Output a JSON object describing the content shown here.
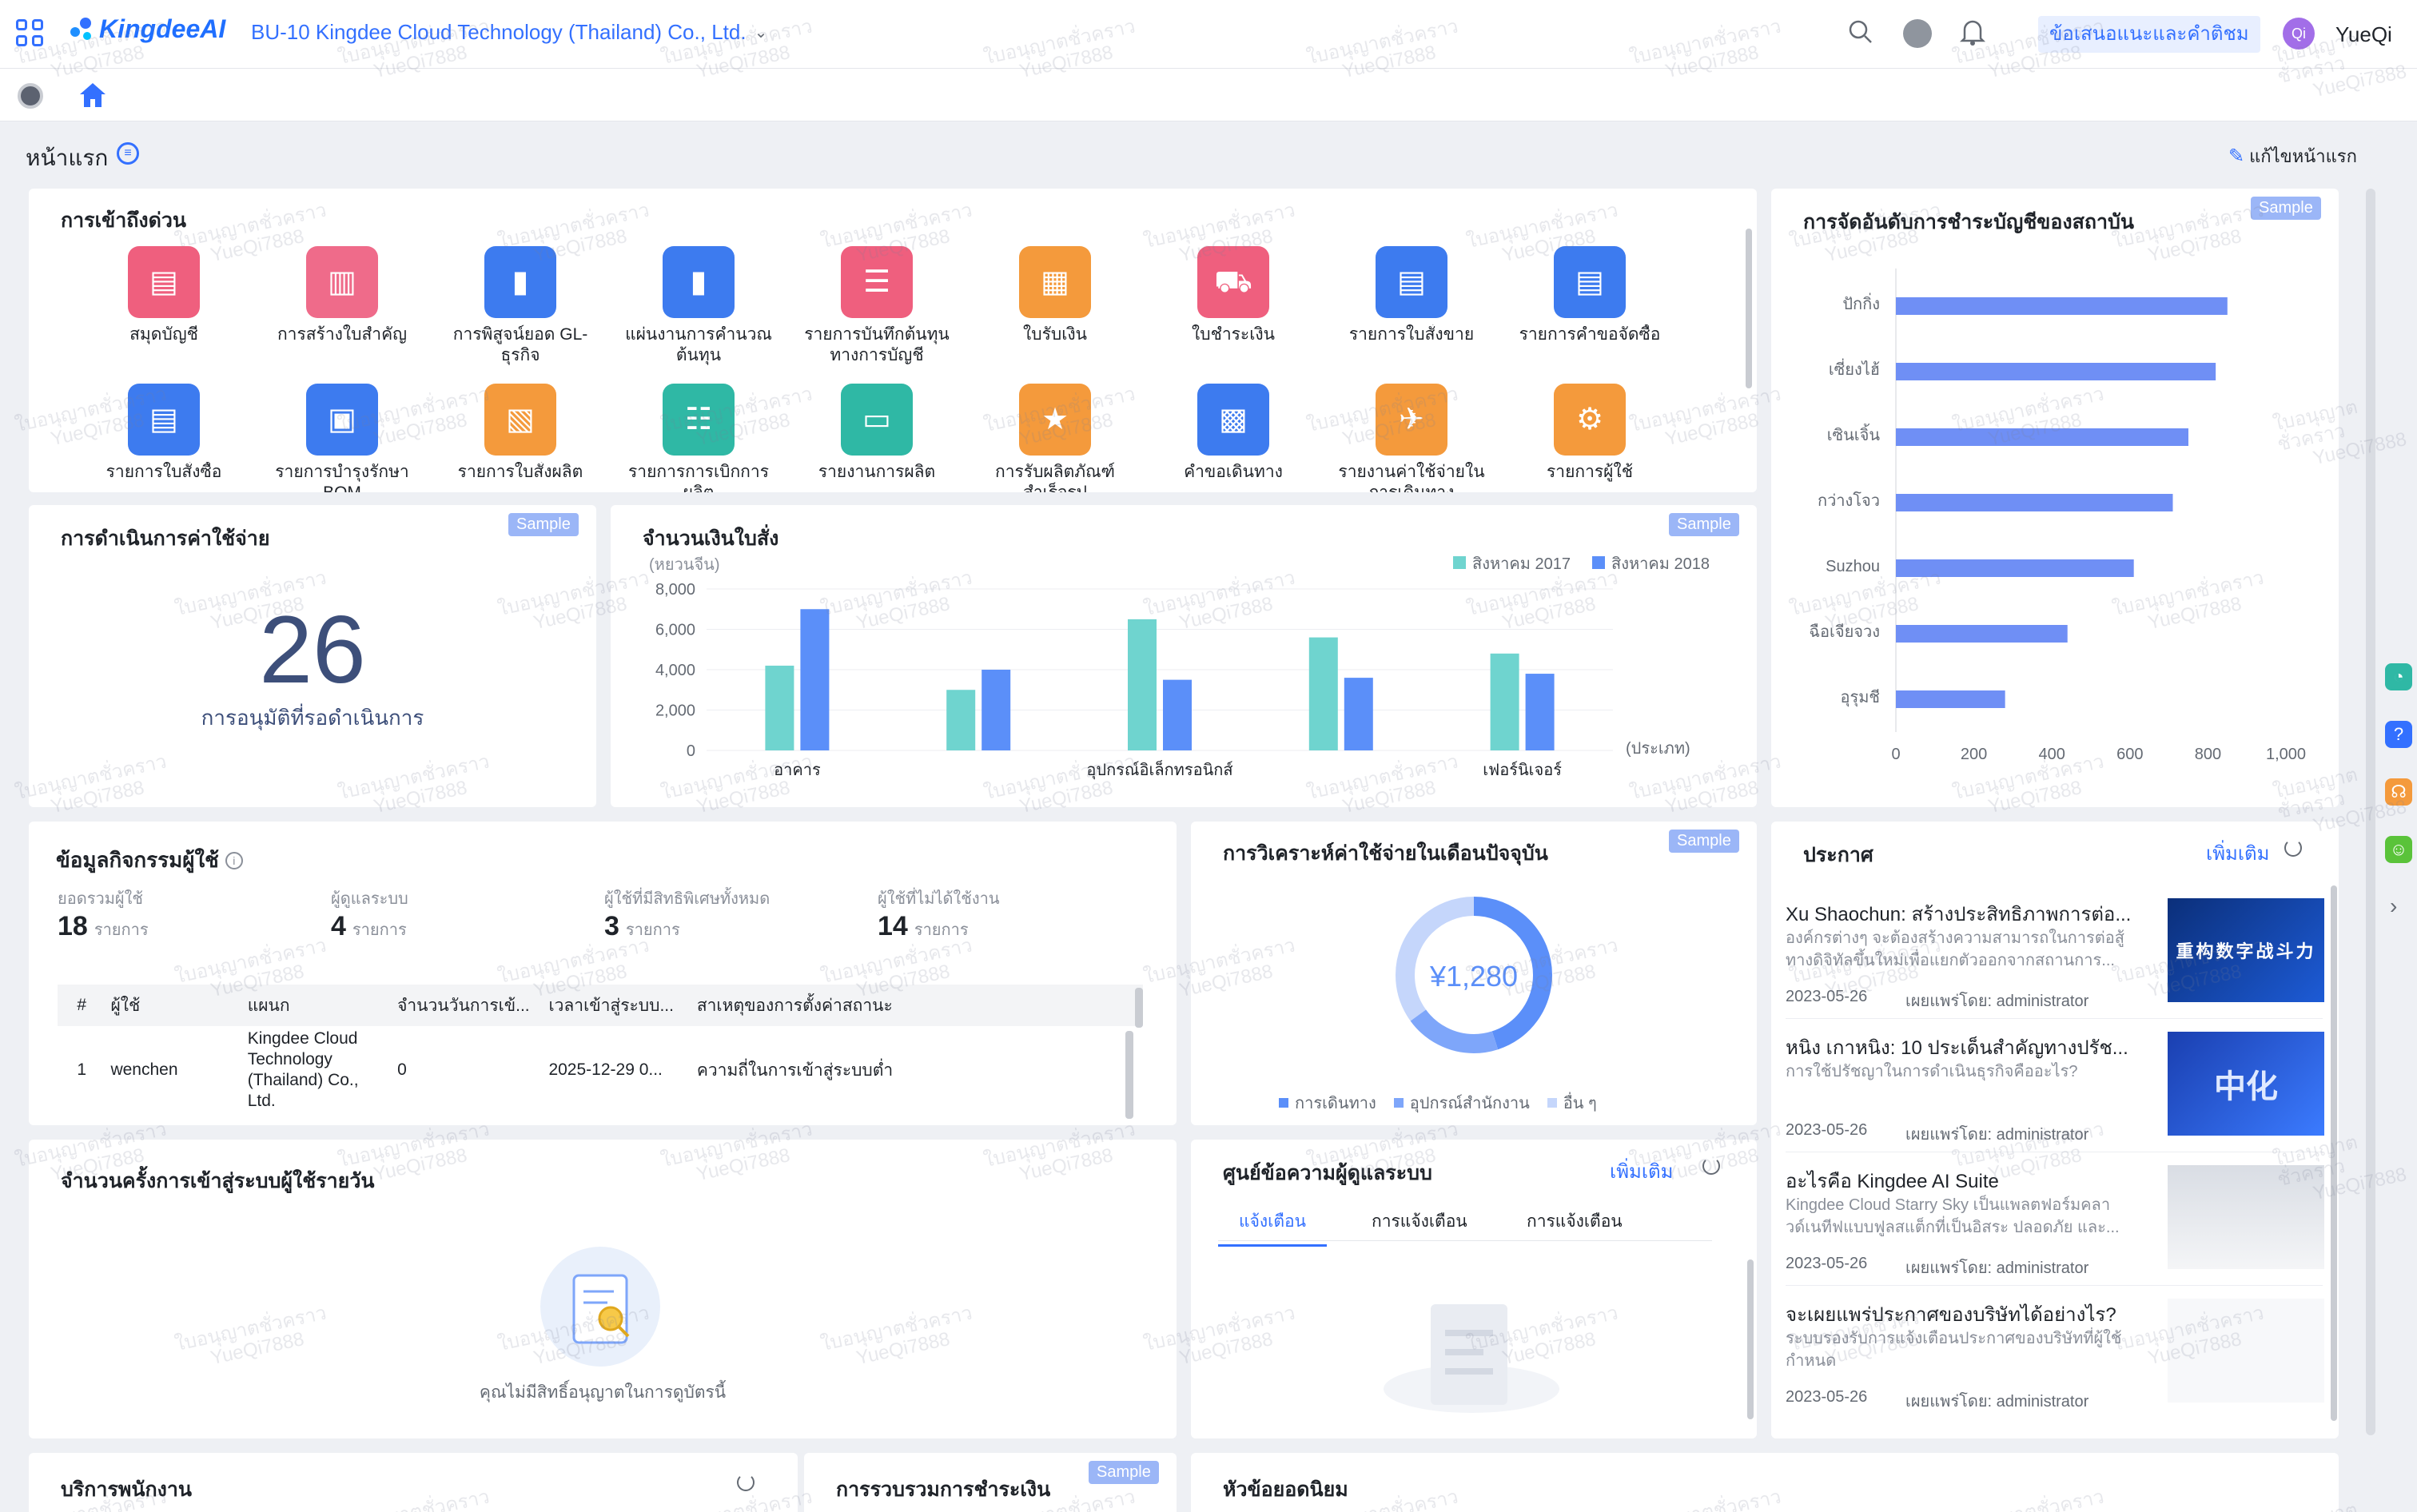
{
  "topbar": {
    "logo_text": "KingdeeAI",
    "org_name": "BU-10 Kingdee Cloud Technology (Thailand) Co., Ltd.",
    "feedback_label": "ข้อเสนอแนะและคำติชม",
    "avatar_initials": "Qi",
    "username": "YueQi"
  },
  "page": {
    "title": "หน้าแรก",
    "edit_label": "แก้ไขหน้าแรก"
  },
  "sample_label": "Sample",
  "quick_access": {
    "title": "การเข้าถึงด่วน",
    "items": [
      {
        "label": "สมุดบัญชี",
        "color": "#ef5f7e",
        "icon": "ledger-icon"
      },
      {
        "label": "การสร้างใบสำคัญ",
        "color": "#ef6b8a",
        "icon": "voucher-icon"
      },
      {
        "label": "การพิสูจน์ยอด GL-ธุรกิจ",
        "color": "#3d7bef",
        "icon": "bookmark-icon"
      },
      {
        "label": "แผ่นงานการคำนวณต้นทุน",
        "color": "#3d7bef",
        "icon": "bookmark-icon"
      },
      {
        "label": "รายการบันทึกต้นทุนทางการบัญชี",
        "color": "#ef5f7e",
        "icon": "list-icon"
      },
      {
        "label": "ใบรับเงิน",
        "color": "#f49a3c",
        "icon": "receipt-icon"
      },
      {
        "label": "ใบชำระเงิน",
        "color": "#ef5f7e",
        "icon": "cart-icon"
      },
      {
        "label": "รายการใบสั่งขาย",
        "color": "#3d7bef",
        "icon": "document-icon"
      },
      {
        "label": "รายการคำขอจัดซื้อ",
        "color": "#3d7bef",
        "icon": "document-icon"
      },
      {
        "label": "รายการใบสั่งซื้อ",
        "color": "#3d7bef",
        "icon": "document-icon"
      },
      {
        "label": "รายการบำรุงรักษา BOM",
        "color": "#3d7bef",
        "icon": "bom-icon"
      },
      {
        "label": "รายการใบสั่งผลิต",
        "color": "#f49a3c",
        "icon": "production-order-icon"
      },
      {
        "label": "รายการการเบิกการผลิต",
        "color": "#2fb8a5",
        "icon": "checklist-icon"
      },
      {
        "label": "รายงานการผลิต",
        "color": "#2fb8a5",
        "icon": "monitor-icon"
      },
      {
        "label": "การรับผลิตภัณฑ์สำเร็จรูป",
        "color": "#f49a3c",
        "icon": "star-icon"
      },
      {
        "label": "คำขอเดินทาง",
        "color": "#3d7bef",
        "icon": "suitcase-icon"
      },
      {
        "label": "รายงานค่าใช้จ่ายในการเดินทาง",
        "color": "#f49a3c",
        "icon": "plane-icon"
      },
      {
        "label": "รายการผู้ใช้",
        "color": "#f49a3c",
        "icon": "user-settings-icon"
      }
    ]
  },
  "expense_ops": {
    "title": "การดำเนินการค่าใช้จ่าย",
    "count": "26",
    "caption": "การอนุมัติที่รอดำเนินการ"
  },
  "order_amount": {
    "title": "จำนวนเงินใบสั่ง",
    "unit_label": "(หยวนจีน)",
    "x_unit_label": "(ประเภท)",
    "legend": [
      "สิงหาคม 2017",
      "สิงหาคม 2018"
    ],
    "colors": [
      "#6fd4cf",
      "#5b8ff9"
    ]
  },
  "ranking": {
    "title": "การจัดอันดับการชำระบัญชีของสถาบัน",
    "color": "#6f8ff5"
  },
  "user_activity": {
    "title": "ข้อมูลกิจกรรมผู้ใช้",
    "stats": [
      {
        "label": "ยอดรวมผู้ใช้",
        "value": "18",
        "unit": "รายการ"
      },
      {
        "label": "ผู้ดูแลระบบ",
        "value": "4",
        "unit": "รายการ"
      },
      {
        "label": "ผู้ใช้ที่มีสิทธิพิเศษทั้งหมด",
        "value": "3",
        "unit": "รายการ"
      },
      {
        "label": "ผู้ใช้ที่ไม่ได้ใช้งาน",
        "value": "14",
        "unit": "รายการ"
      }
    ],
    "columns": [
      "#",
      "ผู้ใช้",
      "แผนก",
      "จำนวนวันการเข้...",
      "เวลาเข้าสู่ระบบ...",
      "สาเหตุของการตั้งค่าสถานะ"
    ],
    "rows": [
      [
        "1",
        "wenchen",
        "Kingdee Cloud Technology (Thailand) Co., Ltd.",
        "0",
        "2025-12-29 0...",
        "ความถี่ในการเข้าสู่ระบบต่ำ"
      ]
    ]
  },
  "expense_analysis": {
    "title": "การวิเคราะห์ค่าใช้จ่ายในเดือนปัจจุบัน",
    "total": "¥1,280",
    "legend": [
      "การเดินทาง",
      "อุปกรณ์สำนักงาน",
      "อื่น ๆ"
    ],
    "colors": [
      "#5b8ff9",
      "#7ea6fa",
      "#c5d6fb"
    ]
  },
  "announcements": {
    "title": "ประกาศ",
    "more_label": "เพิ่มเติม",
    "items": [
      {
        "title": "Xu Shaochun: สร้างประสิทธิภาพการต่อ...",
        "summary": "องค์กรต่างๆ จะต้องสร้างความสามารถในการต่อสู้ทางดิจิทัลขึ้นใหม่เพื่อแยกตัวออกจากสถานการ...",
        "date": "2023-05-26",
        "publisher": "เผยแพร่โดย: administrator",
        "thumb_text": "重构数字战斗力"
      },
      {
        "title": "หนิง เกาหนิง: 10 ประเด็นสำคัญทางปรัช...",
        "summary": "การใช้ปรัชญาในการดำเนินธุรกิจคืออะไร?",
        "date": "2023-05-26",
        "publisher": "เผยแพร่โดย: administrator",
        "thumb_text": "中化"
      },
      {
        "title": "อะไรคือ Kingdee AI Suite",
        "summary": "Kingdee Cloud Starry Sky เป็นแพลตฟอร์มคลาวด์เนทีฟแบบฟูลสแต็กที่เป็นอิสระ ปลอดภัย และ...",
        "date": "2023-05-26",
        "publisher": "เผยแพร่โดย: administrator",
        "thumb_text": ""
      },
      {
        "title": "จะเผยแพร่ประกาศของบริษัทได้อย่างไร?",
        "summary": "ระบบรองรับการแจ้งเตือนประกาศของบริษัทที่ผู้ใช้กำหนด",
        "date": "2023-05-26",
        "publisher": "เผยแพร่โดย: administrator",
        "thumb_text": ""
      }
    ]
  },
  "daily_logins": {
    "title": "จำนวนครั้งการเข้าสู่ระบบผู้ใช้รายวัน",
    "empty_text": "คุณไม่มีสิทธิ์อนุญาตในการดูบัตรนี้"
  },
  "message_center": {
    "title": "ศูนย์ข้อความผู้ดูแลระบบ",
    "more_label": "เพิ่มเติม",
    "tabs": [
      "แจ้งเตือน",
      "การแจ้งเตือน",
      "การแจ้งเตือน"
    ]
  },
  "bottom_cards": {
    "employee_services": "บริการพนักงาน",
    "payment_summary": "การรวบรวมการชำระเงิน",
    "popular_topics": "หัวข้อยอดนิยม"
  },
  "watermark": {
    "line1": "ใบอนุญาตชั่วคราว",
    "line2": "YueQi7888"
  },
  "chart_data": [
    {
      "type": "bar",
      "title": "จำนวนเงินใบสั่ง",
      "ylabel": "(หยวนจีน)",
      "xlabel": "(ประเภท)",
      "categories": [
        "อาคาร",
        "",
        "อุปกรณ์อิเล็กทรอนิกส์",
        "",
        "เฟอร์นิเจอร์"
      ],
      "ylim": [
        0,
        8000
      ],
      "yticks": [
        "0",
        "2,000",
        "4,000",
        "6,000",
        "8,000"
      ],
      "series": [
        {
          "name": "สิงหาคม 2017",
          "values": [
            4200,
            3000,
            6500,
            5600,
            4800
          ]
        },
        {
          "name": "สิงหาคม 2018",
          "values": [
            7000,
            4000,
            3500,
            3600,
            3800
          ]
        }
      ]
    },
    {
      "type": "bar",
      "orientation": "horizontal",
      "title": "การจัดอันดับการชำระบัญชีของสถาบัน",
      "categories": [
        "ปักกิ่ง",
        "เซี่ยงไฮ้",
        "เซินเจิ้น",
        "กว่างโจว",
        "Suzhou",
        "ฉือเจียจวง",
        "อุรุมชี"
      ],
      "values": [
        850,
        820,
        750,
        710,
        610,
        440,
        280
      ],
      "xlim": [
        0,
        1000
      ],
      "xticks": [
        "0",
        "200",
        "400",
        "600",
        "800",
        "1,000"
      ]
    },
    {
      "type": "pie",
      "donut": true,
      "title": "การวิเคราะห์ค่าใช้จ่ายในเดือนปัจจุบัน",
      "center_label": "¥1,280",
      "categories": [
        "การเดินทาง",
        "อุปกรณ์สำนักงาน",
        "อื่น ๆ"
      ],
      "values": [
        0.45,
        0.2,
        0.35
      ]
    }
  ]
}
